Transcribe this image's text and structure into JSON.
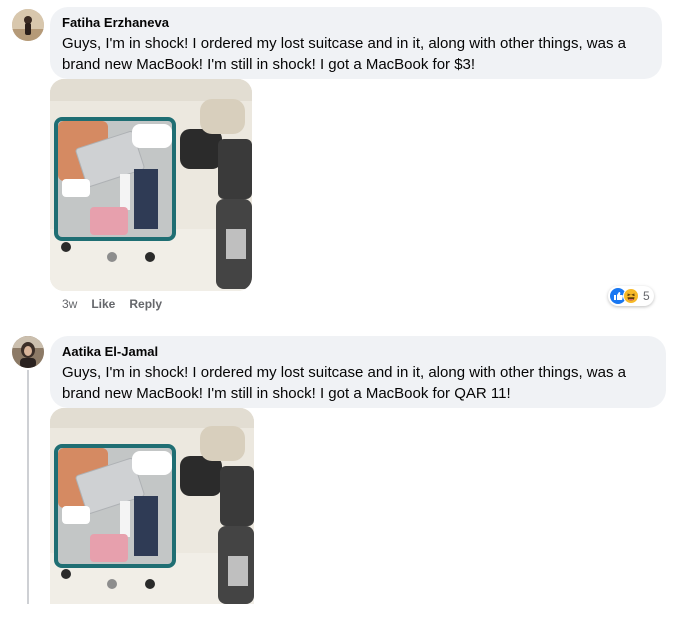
{
  "comments": [
    {
      "author": "Fatiha Erzhaneva",
      "text_line1": "Guys, I'm in shock! I ordered my lost suitcase and in it, along with other things, was a",
      "text_line2": "brand new MacBook! I'm still in shock! I got a MacBook for $3!",
      "time": "3w",
      "like_label": "Like",
      "reply_label": "Reply",
      "reaction_count": "5",
      "reaction_icons": [
        "like-icon",
        "haha-icon"
      ]
    },
    {
      "author": "Aatika El-Jamal",
      "text_line1": "Guys, I'm in shock! I ordered my lost suitcase and in it, along with other things, was a",
      "text_line2": "brand new MacBook! I'm still in shock! I got a MacBook for QAR 11!"
    }
  ],
  "colors": {
    "bubble": "#f0f2f5",
    "meta_text": "#65676b",
    "like_blue": "#1877f2",
    "haha_yellow": "#f7b928"
  }
}
